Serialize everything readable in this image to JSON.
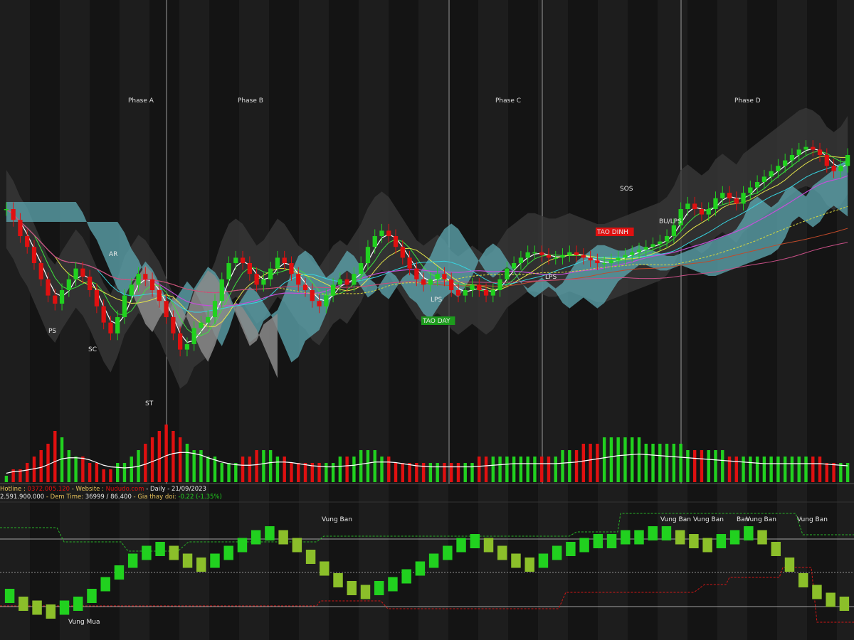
{
  "header": {
    "hotline_label": "Hotline : ",
    "hotline_value": "0372.005.120",
    "website_label": " - Website : ",
    "website_value": "Nududo.com",
    "period": " - Daily ",
    "date": " - 21/09/2023",
    "volume_value": "2.591.900.000",
    "dem_time_label": " - Dem Time: ",
    "dem_time_value": "36999 / 86.400",
    "gia_label": " - Gia thay doi: ",
    "gia_value": "-0.22 (-1.35%)"
  },
  "colors": {
    "background": "#141414",
    "stripe": "#1d1d1d",
    "up": "#21d11f",
    "down": "#e01010",
    "cloud_teal": "#5fa9b3",
    "cloud_gray": "#8a8a8a",
    "band": "#3a3a3a",
    "label_red_bg": "#e01010",
    "label_green_bg": "#1d9c1d"
  },
  "chart_data": {
    "type": "candlestick",
    "phases": [
      "Phase A",
      "Phase B",
      "Phase C",
      "Phase D"
    ],
    "price_panel": {
      "annotations": [
        "PS",
        "SC",
        "AR",
        "ST",
        "LPS",
        "TAO DAY",
        "LPS",
        "TAO DINH",
        "SOS",
        "BU/LPS"
      ],
      "closes": [
        70,
        66,
        60,
        56,
        50,
        44,
        38,
        35,
        40,
        44,
        48,
        45,
        40,
        34,
        28,
        24,
        30,
        38,
        42,
        46,
        44,
        40,
        36,
        30,
        24,
        18,
        20,
        26,
        28,
        30,
        36,
        44,
        50,
        52,
        50,
        46,
        42,
        44,
        48,
        52,
        50,
        46,
        42,
        40,
        36,
        34,
        38,
        42,
        44,
        42,
        46,
        50,
        56,
        60,
        62,
        60,
        56,
        52,
        48,
        44,
        42,
        44,
        46,
        44,
        40,
        38,
        40,
        42,
        40,
        38,
        40,
        44,
        48,
        50,
        52,
        54,
        54,
        53,
        52,
        52,
        53,
        54,
        53,
        52,
        51,
        50,
        50,
        51,
        52,
        53,
        54,
        55,
        56,
        57,
        58,
        60,
        64,
        70,
        72,
        70,
        68,
        70,
        74,
        76,
        74,
        72,
        76,
        78,
        80,
        82,
        84,
        86,
        88,
        90,
        92,
        93,
        92,
        90,
        86,
        84,
        86,
        90
      ]
    },
    "volume_panel": {
      "values": [
        1,
        2,
        2,
        3,
        4,
        5,
        6,
        8,
        7,
        5,
        4,
        4,
        3,
        3,
        2,
        2,
        3,
        3,
        4,
        5,
        6,
        7,
        8,
        9,
        8,
        7,
        6,
        5,
        5,
        4,
        4,
        3,
        3,
        3,
        4,
        4,
        5,
        5,
        5,
        4,
        4,
        3,
        3,
        3,
        3,
        3,
        3,
        3,
        4,
        4,
        4,
        5,
        5,
        5,
        4,
        4,
        3,
        3,
        3,
        3,
        3,
        3,
        3,
        3,
        3,
        3,
        3,
        3,
        4,
        4,
        4,
        4,
        4,
        4,
        4,
        4,
        4,
        4,
        4,
        4,
        5,
        5,
        5,
        6,
        6,
        6,
        7,
        7,
        7,
        7,
        7,
        7,
        6,
        6,
        6,
        6,
        6,
        6,
        5,
        5,
        5,
        5,
        5,
        5,
        4,
        4,
        4,
        4,
        4,
        4,
        4,
        4,
        4,
        4,
        4,
        4,
        4,
        4,
        3,
        3,
        3,
        3
      ]
    },
    "oscillator_panel": {
      "annotations": [
        "Vung Ban",
        "Vung Ban",
        "Vung Ban",
        "Ban",
        "Vung Ban",
        "Vung Ban",
        "Vung Mua"
      ],
      "values": [
        -0.6,
        -0.8,
        -0.9,
        -1.0,
        -0.9,
        -0.8,
        -0.6,
        -0.3,
        0.0,
        0.3,
        0.5,
        0.6,
        0.5,
        0.3,
        0.2,
        0.3,
        0.5,
        0.7,
        0.9,
        1.0,
        0.9,
        0.7,
        0.4,
        0.1,
        -0.2,
        -0.4,
        -0.5,
        -0.4,
        -0.3,
        -0.1,
        0.1,
        0.3,
        0.5,
        0.7,
        0.8,
        0.7,
        0.5,
        0.3,
        0.2,
        0.3,
        0.5,
        0.6,
        0.7,
        0.8,
        0.8,
        0.9,
        0.9,
        1.0,
        1.0,
        0.9,
        0.8,
        0.7,
        0.8,
        0.9,
        1.0,
        0.9,
        0.6,
        0.2,
        -0.2,
        -0.5,
        -0.7,
        -0.8
      ]
    }
  }
}
